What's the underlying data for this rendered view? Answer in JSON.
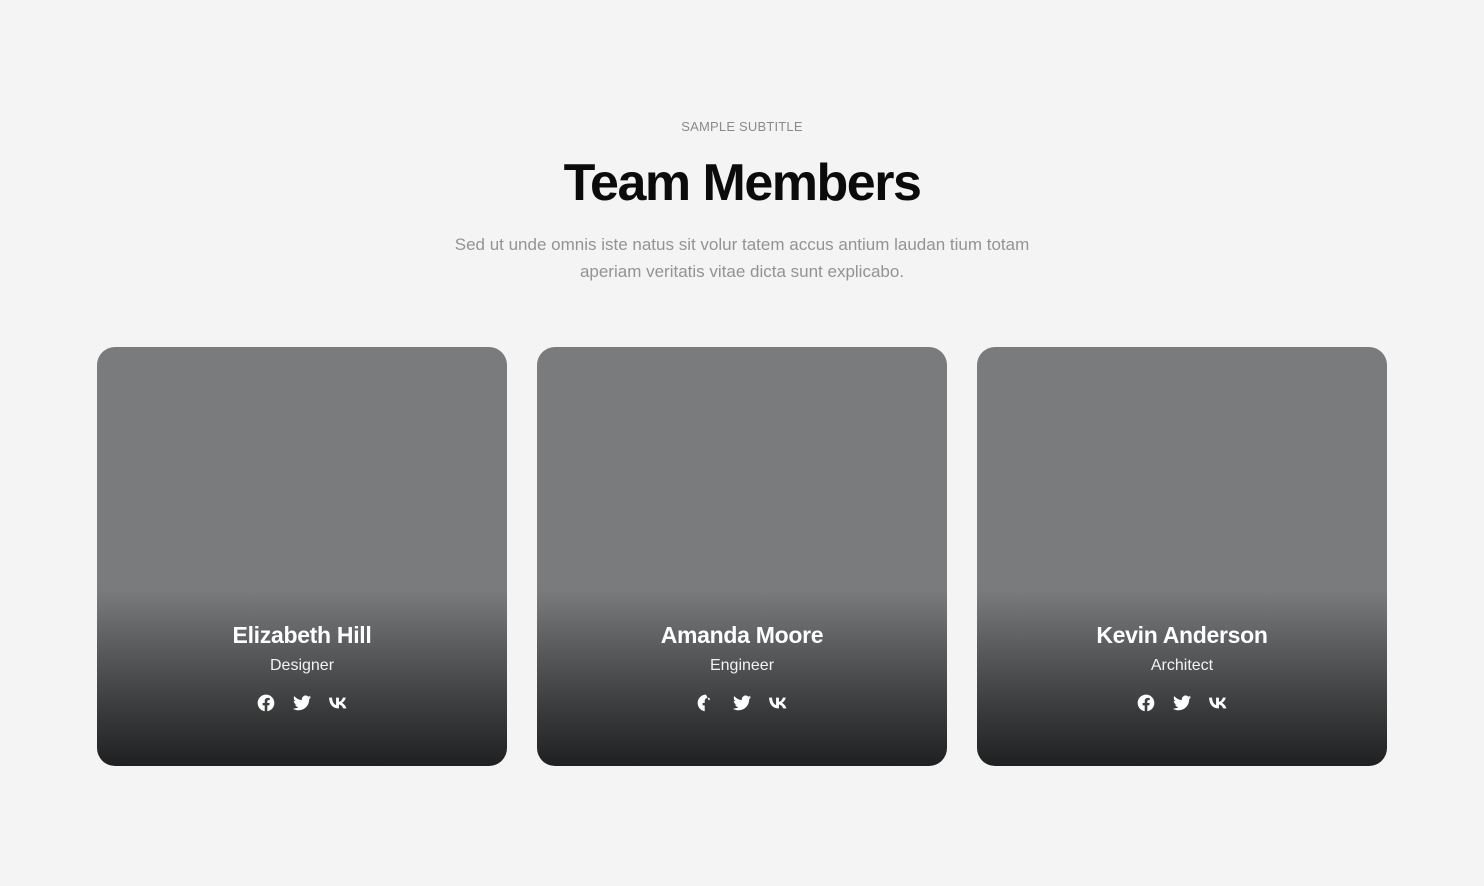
{
  "header": {
    "subtitle": "SAMPLE SUBTITLE",
    "title": "Team Members",
    "description": "Sed ut unde omnis iste natus sit volur tatem accus antium laudan tium totam aperiam veritatis vitae dicta sunt explicabo."
  },
  "members": [
    {
      "name": "Elizabeth Hill",
      "role": "Designer",
      "socials": [
        "facebook-icon",
        "twitter-icon",
        "vk-icon"
      ]
    },
    {
      "name": "Amanda Moore",
      "role": "Engineer",
      "socials": [
        "facebook-icon",
        "twitter-icon",
        "vk-icon"
      ]
    },
    {
      "name": "Kevin Anderson",
      "role": "Architect",
      "socials": [
        "facebook-icon",
        "twitter-icon",
        "vk-icon"
      ]
    }
  ],
  "colors": {
    "background": "#f4f4f4",
    "card_top": "#7a7b7d",
    "card_bottom": "#1f2021",
    "title": "#0b0b0b",
    "muted_text": "#939393"
  }
}
